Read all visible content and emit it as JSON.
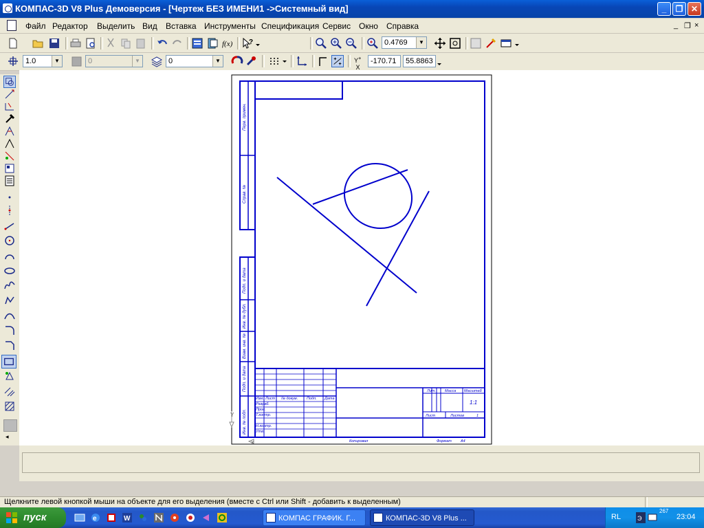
{
  "window": {
    "title": "КОМПАС-3D V8 Plus Демоверсия - [Чертеж БЕЗ ИМЕНИ1 ->Системный вид]",
    "minimize_label": "_",
    "maximize_label": "❐",
    "close_label": "✕"
  },
  "menu": {
    "items": [
      "Файл",
      "Редактор",
      "Выделить",
      "Вид",
      "Вставка",
      "Инструменты",
      "Спецификация",
      "Сервис",
      "Окно",
      "Справка"
    ],
    "mdi_controls": [
      "_",
      "❐",
      "×"
    ]
  },
  "toolbar1": {
    "zoom_value": "0.4769"
  },
  "toolbar2": {
    "step_value": "1.0",
    "layer_number": "0",
    "style_value": "0",
    "cursor_x": "-170.71",
    "cursor_y": "55.8863",
    "coord_label": "Y+X"
  },
  "drawing": {
    "stamp_labels": {
      "izm": "Изм.",
      "list": "Лист",
      "doc_no": "№ докум.",
      "podp": "Подп.",
      "data": "Дата",
      "razrab": "Разраб.",
      "prov": "Пров.",
      "tkontr": "Т.контр.",
      "nkontr": "Н.контр.",
      "utv": "Утв.",
      "lit": "Лит.",
      "massa": "Масса",
      "masshtab": "Масштаб",
      "scale_value": "1:1",
      "list2": "Лист",
      "listov": "Листов",
      "listov_value": "1",
      "kopiroval": "Копировал",
      "format": "Формат",
      "format_value": "A4"
    },
    "side_labels": [
      "Перв. примен.",
      "Справ. №",
      "Подп. и дата",
      "Инв. № дубл.",
      "Взам. инв. №",
      "Подп. и дата",
      "Инв. № подл."
    ],
    "axis_y": "Y",
    "axis_x": "X"
  },
  "status": {
    "text": "Щелкните левой кнопкой мыши на объекте для его выделения (вместе с Ctrl или Shift - добавить к выделенным)"
  },
  "taskbar": {
    "start_label": "пуск",
    "tasks": [
      {
        "label": "КОМПАС ГРАФИК. Г...",
        "active": false
      },
      {
        "label": "КОМПАС-3D V8 Plus ...",
        "active": true
      }
    ],
    "lang": "RL",
    "clock": "23:04",
    "tray_number": "267"
  },
  "colors": {
    "drawing_blue": "#0000cc",
    "titlebar": "#0a5fd8",
    "start_green": "#2e8b2e"
  },
  "icons": {
    "left_toolbar": [
      "geometry-icon",
      "dimensions-icon",
      "designations-icon",
      "edit-icon",
      "parametrization-icon",
      "measure-icon",
      "select-icon",
      "associative-view-icon",
      "spec-icon",
      "point-icon",
      "aux-line-icon",
      "segment-icon",
      "circle-icon",
      "arc-icon",
      "ellipse-icon",
      "spline-icon",
      "polyline-icon",
      "bezier-icon",
      "fillet-icon",
      "chamfer-icon",
      "rectangle-icon",
      "hatch-icon",
      "equidistant-icon",
      "contour-icon"
    ],
    "rect_flyout": [
      "rectangle-icon",
      "rectangle-center-icon",
      "polygon-icon"
    ]
  }
}
